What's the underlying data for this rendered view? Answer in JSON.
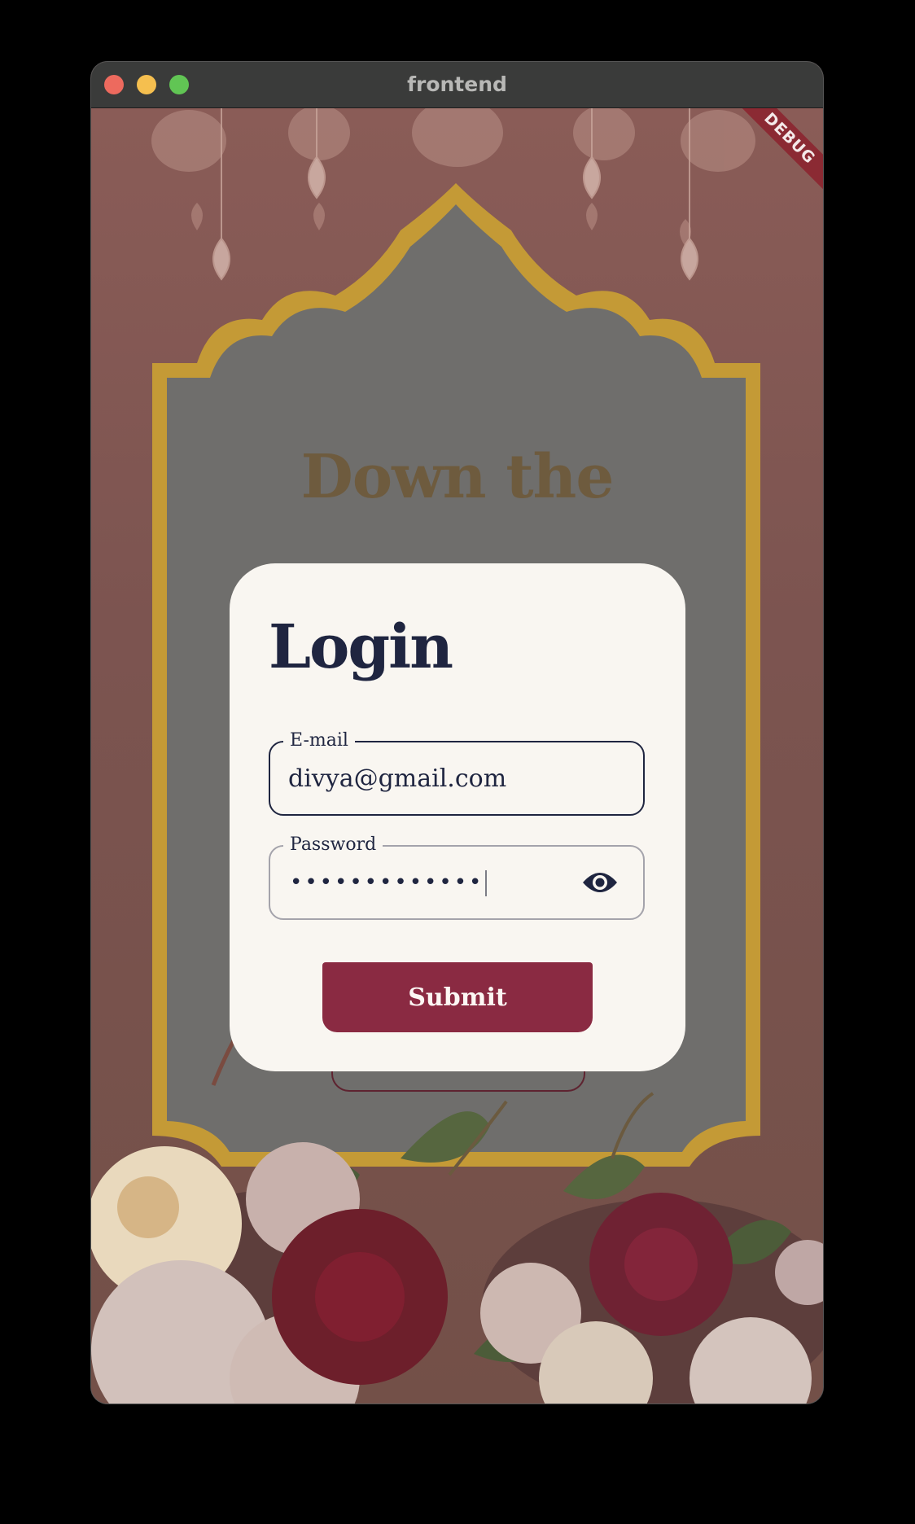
{
  "window": {
    "title": "frontend"
  },
  "debug_banner": {
    "label": "DEBUG"
  },
  "background": {
    "heading": "Down the"
  },
  "login": {
    "title": "Login",
    "email": {
      "label": "E-mail",
      "value": "divya@gmail.com"
    },
    "password": {
      "label": "Password",
      "masked_value": "•••••••••••••",
      "toggle_icon": "eye-icon"
    },
    "submit_label": "Submit"
  },
  "colors": {
    "card": "#f9f6f1",
    "title": "#1f2540",
    "submit": "#8a2a42",
    "background": "#7c5450",
    "gold": "#c6a03e"
  }
}
